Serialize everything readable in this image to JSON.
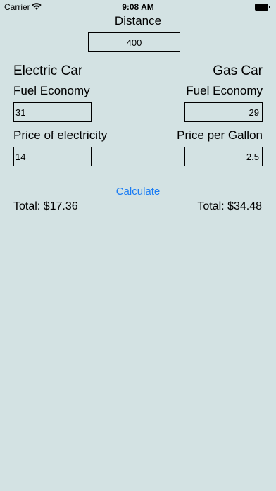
{
  "status_bar": {
    "carrier": "Carrier",
    "time": "9:08 AM"
  },
  "distance": {
    "label": "Distance",
    "value": "400"
  },
  "electric": {
    "heading": "Electric Car",
    "economy_label": "Fuel Economy",
    "economy_value": "31",
    "price_label": "Price of electricity",
    "price_value": "14",
    "total": "Total: $17.36"
  },
  "gas": {
    "heading": "Gas Car",
    "economy_label": "Fuel Economy",
    "economy_value": "29",
    "price_label": "Price per Gallon",
    "price_value": "2.5",
    "total": "Total: $34.48"
  },
  "calculate_label": "Calculate",
  "colors": {
    "background": "#d3e2e3",
    "accent": "#1a7cf4"
  }
}
